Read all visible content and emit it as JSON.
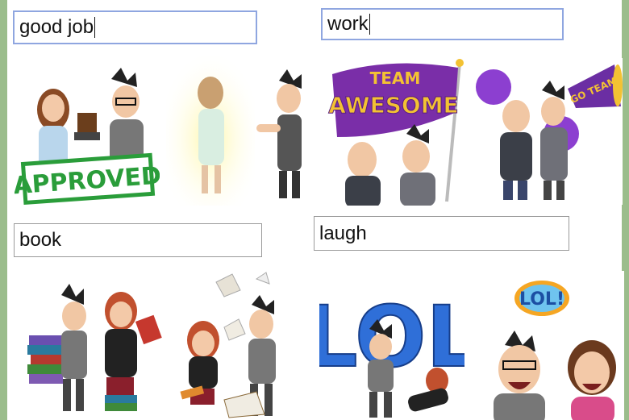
{
  "searches": {
    "good_job": {
      "value": "good job"
    },
    "work": {
      "value": "work"
    },
    "book": {
      "value": "book"
    },
    "laugh": {
      "value": "laugh"
    }
  },
  "stickers": {
    "approved_text": "APPROVED",
    "team_text": "TEAM",
    "awesome_text": "AWESOME",
    "go_team_text": "GO TEAM",
    "lol_bubble_text": "LOL!",
    "lol_big_text": "LOL"
  },
  "colors": {
    "edge_green": "#9bbd8c",
    "focus_blue": "#8fa6e0",
    "approved_green": "#2a9d3a",
    "flag_purple": "#7a2ea8",
    "flag_gold": "#f3c233"
  }
}
